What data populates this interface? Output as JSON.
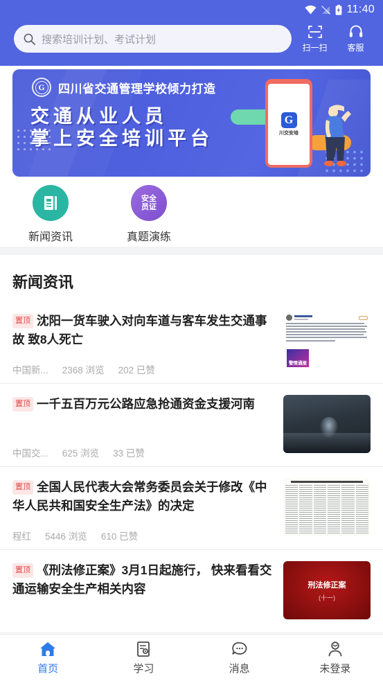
{
  "status_bar": {
    "time": "11:40",
    "icons": [
      "wifi-icon",
      "no-signal-icon",
      "battery-charging-icon"
    ]
  },
  "header": {
    "search": {
      "placeholder": "搜索培训计划、考试计划",
      "icon": "search-icon",
      "value": ""
    },
    "actions": [
      {
        "label": "扫一扫",
        "icon": "scan-icon"
      },
      {
        "label": "客服",
        "icon": "headset-icon"
      }
    ],
    "background_color": "#5165E0"
  },
  "banner": {
    "subtitle": "四川省交通管理学校倾力打造",
    "title_line1": "交通从业人员",
    "title_line2": "掌上安全培训平台",
    "logo_letter": "G",
    "phone_app_letter": "G",
    "phone_app_name": "川交安培",
    "accent_green": "#6FD8AE",
    "accent_orange": "#F5A13C",
    "accent_red": "#F06B62"
  },
  "shortcuts": [
    {
      "label": "新闻资讯",
      "icon": "news-document-icon",
      "color": "#2BB6A3",
      "badge_top": "",
      "badge_bottom": ""
    },
    {
      "label": "真题演练",
      "icon": "safety-certificate-icon",
      "color": "#8B5BD6",
      "badge_top": "安全",
      "badge_bottom": "员证"
    }
  ],
  "news_section": {
    "title": "新闻资讯",
    "badge_text": "置顶",
    "views_unit": "浏览",
    "likes_unit": "已赞",
    "items": [
      {
        "headline": "沈阳一货车驶入对向车道与客车发生交通事故 致8人死亡",
        "source": "中国新...",
        "views": "2368",
        "likes": "202",
        "thumb": "weibo-post-thumbnail",
        "thumb_caption": "警情通报"
      },
      {
        "headline": "一千五百万元公路应急抢通资金支援河南",
        "source": "中国交...",
        "views": "625",
        "likes": "33",
        "thumb": "water-splash-thumbnail",
        "thumb_caption": ""
      },
      {
        "headline": "全国人民代表大会常务委员会关于修改《中华人民共和国安全生产法》的决定",
        "source": "程红",
        "views": "5446",
        "likes": "610",
        "thumb": "newspaper-thumbnail",
        "thumb_caption": ""
      },
      {
        "headline": "《刑法修正案》3月1日起施行， 快来看看交通运输安全生产相关内容",
        "source": "",
        "views": "",
        "likes": "",
        "thumb": "criminal-law-thumbnail",
        "thumb_caption": "刑法修正案",
        "thumb_caption2": "(十一)"
      }
    ]
  },
  "tabbar": {
    "active_color": "#2E7BE8",
    "items": [
      {
        "label": "首页",
        "icon": "home-icon",
        "active": true
      },
      {
        "label": "学习",
        "icon": "study-icon",
        "active": false
      },
      {
        "label": "消息",
        "icon": "message-icon",
        "active": false
      },
      {
        "label": "未登录",
        "icon": "user-icon",
        "active": false
      }
    ]
  }
}
